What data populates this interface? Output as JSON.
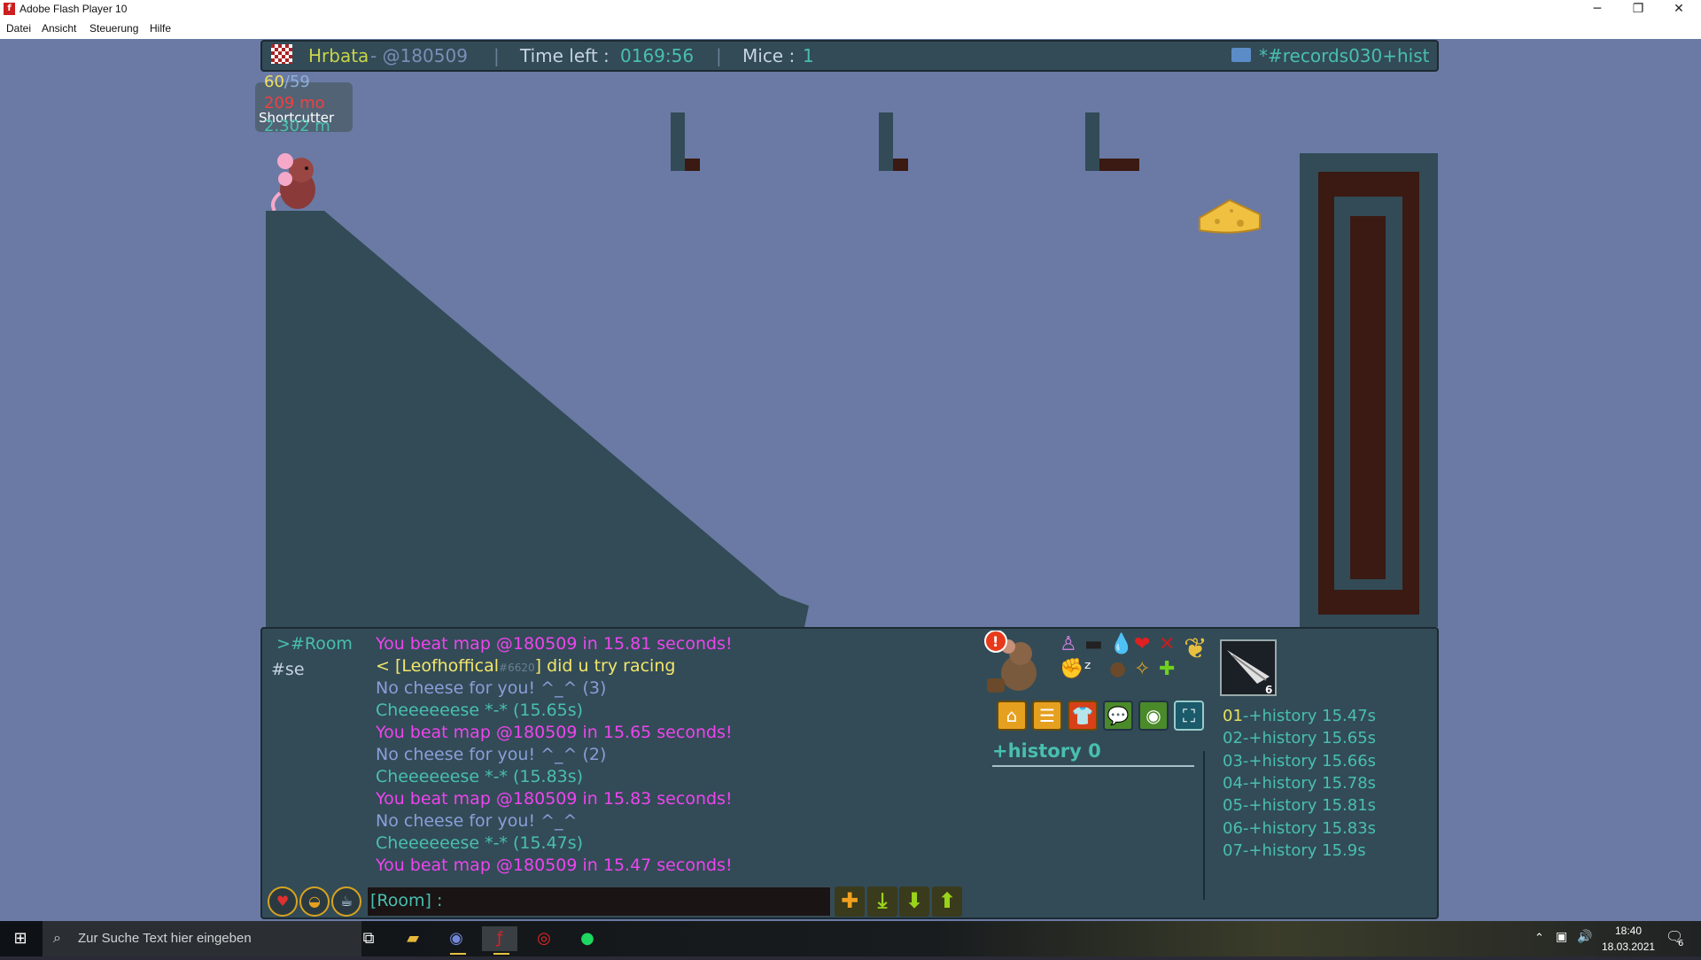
{
  "window": {
    "title": "Adobe Flash Player 10",
    "app_icon": "flash-icon",
    "minimize": "─",
    "restore": "❐",
    "close": "✕"
  },
  "menu": {
    "items": [
      "Datei",
      "Ansicht",
      "Steuerung",
      "Hilfe"
    ]
  },
  "topbar": {
    "map_author": "Hrbata",
    "map_code": " - @180509",
    "sep": "|",
    "time_label": "Time left :",
    "time_value": "0169:56",
    "mice_label": "Mice :",
    "mice_value": "1",
    "room": "*#records030+hist"
  },
  "stats": {
    "fps": "60",
    "fps_max": "59",
    "line2": "209 mo",
    "line3": "Shortcutter",
    "line4": "2.302 m"
  },
  "chat": {
    "channels": [
      ">#Room",
      "#se"
    ],
    "messages": [
      {
        "text": "You beat map @180509 in 15.81 seconds!",
        "color": "#ee44ee"
      },
      {
        "text": "< [Leofhoffical",
        "tag": "#6620",
        "after": "] did u try racing",
        "color": "#f4e66a"
      },
      {
        "text": "No cheese for you! ^_^ (3)",
        "color": "#8a9ed8"
      },
      {
        "text": "Cheeeeeese *-* (15.65s)",
        "color": "#49bfb0"
      },
      {
        "text": "You beat map @180509 in 15.65 seconds!",
        "color": "#ee44ee"
      },
      {
        "text": "No cheese for you! ^_^ (2)",
        "color": "#8a9ed8"
      },
      {
        "text": "Cheeeeeese *-* (15.83s)",
        "color": "#49bfb0"
      },
      {
        "text": "You beat map @180509 in 15.83 seconds!",
        "color": "#ee44ee"
      },
      {
        "text": "No cheese for you! ^_^",
        "color": "#8a9ed8"
      },
      {
        "text": "Cheeeeeese *-* (15.47s)",
        "color": "#49bfb0"
      },
      {
        "text": "You beat map @180509 in 15.47 seconds!",
        "color": "#ee44ee"
      }
    ],
    "input_placeholder": "[Room] :"
  },
  "history": {
    "label": "+history 0"
  },
  "records": [
    {
      "rank": "01",
      "name": "+history",
      "time": "15.47s"
    },
    {
      "rank": "02",
      "name": "+history",
      "time": "15.65s"
    },
    {
      "rank": "03",
      "name": "+history",
      "time": "15.66s"
    },
    {
      "rank": "04",
      "name": "+history",
      "time": "15.78s"
    },
    {
      "rank": "05",
      "name": "+history",
      "time": "15.81s"
    },
    {
      "rank": "06",
      "name": "+history",
      "time": "15.83s"
    },
    {
      "rank": "07",
      "name": "+history",
      "time": "15.9s"
    }
  ],
  "shaman_badge": "6",
  "taskbar": {
    "search_placeholder": "Zur Suche Text hier eingeben",
    "time": "18:40",
    "date": "18.03.2021",
    "notifications": "6"
  },
  "colors": {
    "game_bg": "#6a7aa4",
    "ground": "#324b57",
    "accent_teal": "#49bfb0",
    "accent_gold": "#e6a020"
  }
}
